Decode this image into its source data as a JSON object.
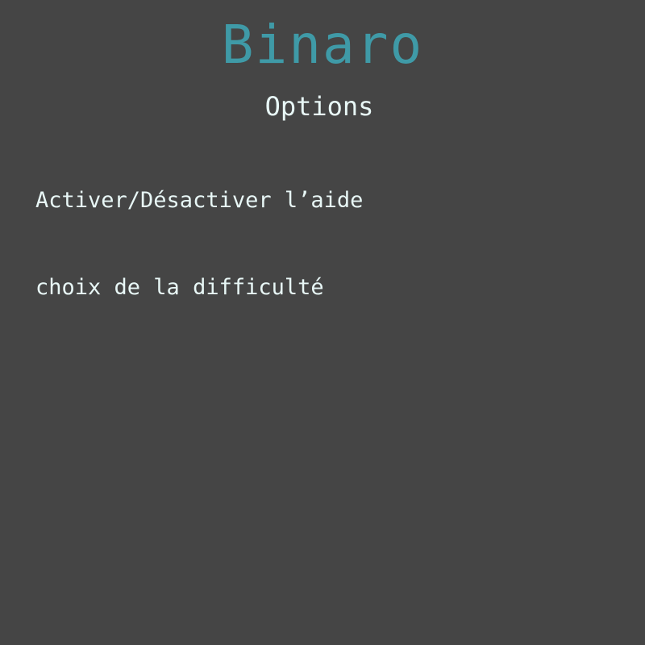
{
  "app": {
    "title": "Binaro"
  },
  "screen": {
    "title": "Options"
  },
  "menu": {
    "items": [
      {
        "label": "Activer/Désactiver l’aide"
      },
      {
        "label": "choix de la difficulté"
      }
    ]
  },
  "colors": {
    "background": "#454545",
    "accent": "#3f9aa7",
    "text": "#e8f7f6"
  }
}
